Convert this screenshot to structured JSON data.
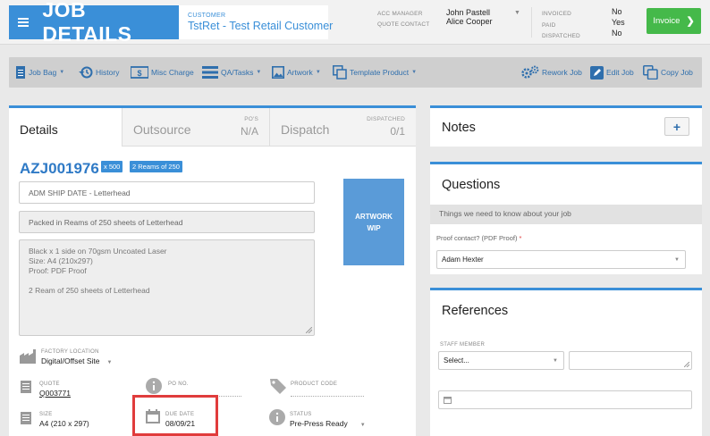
{
  "header": {
    "title": "JOB DETAILS",
    "customer_label": "CUSTOMER",
    "customer_code": "TstRet",
    "customer_sep": " - ",
    "customer_name": "Test Retail Customer",
    "acc_manager_label": "ACC MANAGER",
    "quote_contact_label": "QUOTE CONTACT",
    "acc_manager": "John Pastell",
    "quote_contact": "Alice Cooper",
    "invoiced_label": "INVOICED",
    "paid_label": "PAID",
    "dispatched_label": "DISPATCHED",
    "invoiced": "No",
    "paid": "Yes",
    "dispatched": "No",
    "invoice_button": "Invoice"
  },
  "toolbar": {
    "job_bag": "Job Bag",
    "history": "History",
    "misc_charge": "Misc Charge",
    "qa_tasks": "QA/Tasks",
    "artwork": "Artwork",
    "template_product": "Template Product",
    "rework_job": "Rework Job",
    "edit_job": "Edit Job",
    "copy_job": "Copy Job"
  },
  "tabs": {
    "details": "Details",
    "outsource": "Outsource",
    "pos_label": "PO'S",
    "pos_value": "N/A",
    "dispatch": "Dispatch",
    "dispatched_label": "DISPATCHED",
    "dispatched_value": "0/1"
  },
  "job": {
    "id": "AZJ001976",
    "qty_badge": "x 500",
    "reams_badge": "2 Reams of 250",
    "ship_date": "ADM SHIP DATE - Letterhead",
    "packed": "Packed in Reams of 250 sheets of Letterhead",
    "desc_line1": "Black x 1 side on 70gsm Uncoated Laser",
    "desc_line2": "Size: A4 (210x297)",
    "desc_line3": "Proof: PDF Proof",
    "desc_line4": "2 Ream of 250 sheets of Letterhead",
    "artwork_status_1": "ARTWORK",
    "artwork_status_2": "WIP",
    "factory_location_label": "FACTORY LOCATION",
    "factory_location": "Digital/Offset Site",
    "quote_label": "QUOTE",
    "quote": "Q003771",
    "po_label": "PO NO.",
    "product_code_label": "PRODUCT CODE",
    "size_label": "SIZE",
    "size": "A4 (210 x 297)",
    "due_date_label": "DUE DATE",
    "due_date": "08/09/21",
    "status_label": "STATUS",
    "status": "Pre-Press Ready"
  },
  "notes": {
    "title": "Notes"
  },
  "questions": {
    "title": "Questions",
    "subtitle": "Things we need to know about your job",
    "proof_label": "Proof contact? (PDF Proof)",
    "required_mark": "*",
    "proof_value": "Adam Hexter"
  },
  "references": {
    "title": "References",
    "staff_label": "STAFF MEMBER",
    "staff_placeholder": "Select..."
  },
  "colors": {
    "accent": "#3a8fd8",
    "invoice_green": "#45b94a",
    "highlight_red": "#e03c3c"
  }
}
